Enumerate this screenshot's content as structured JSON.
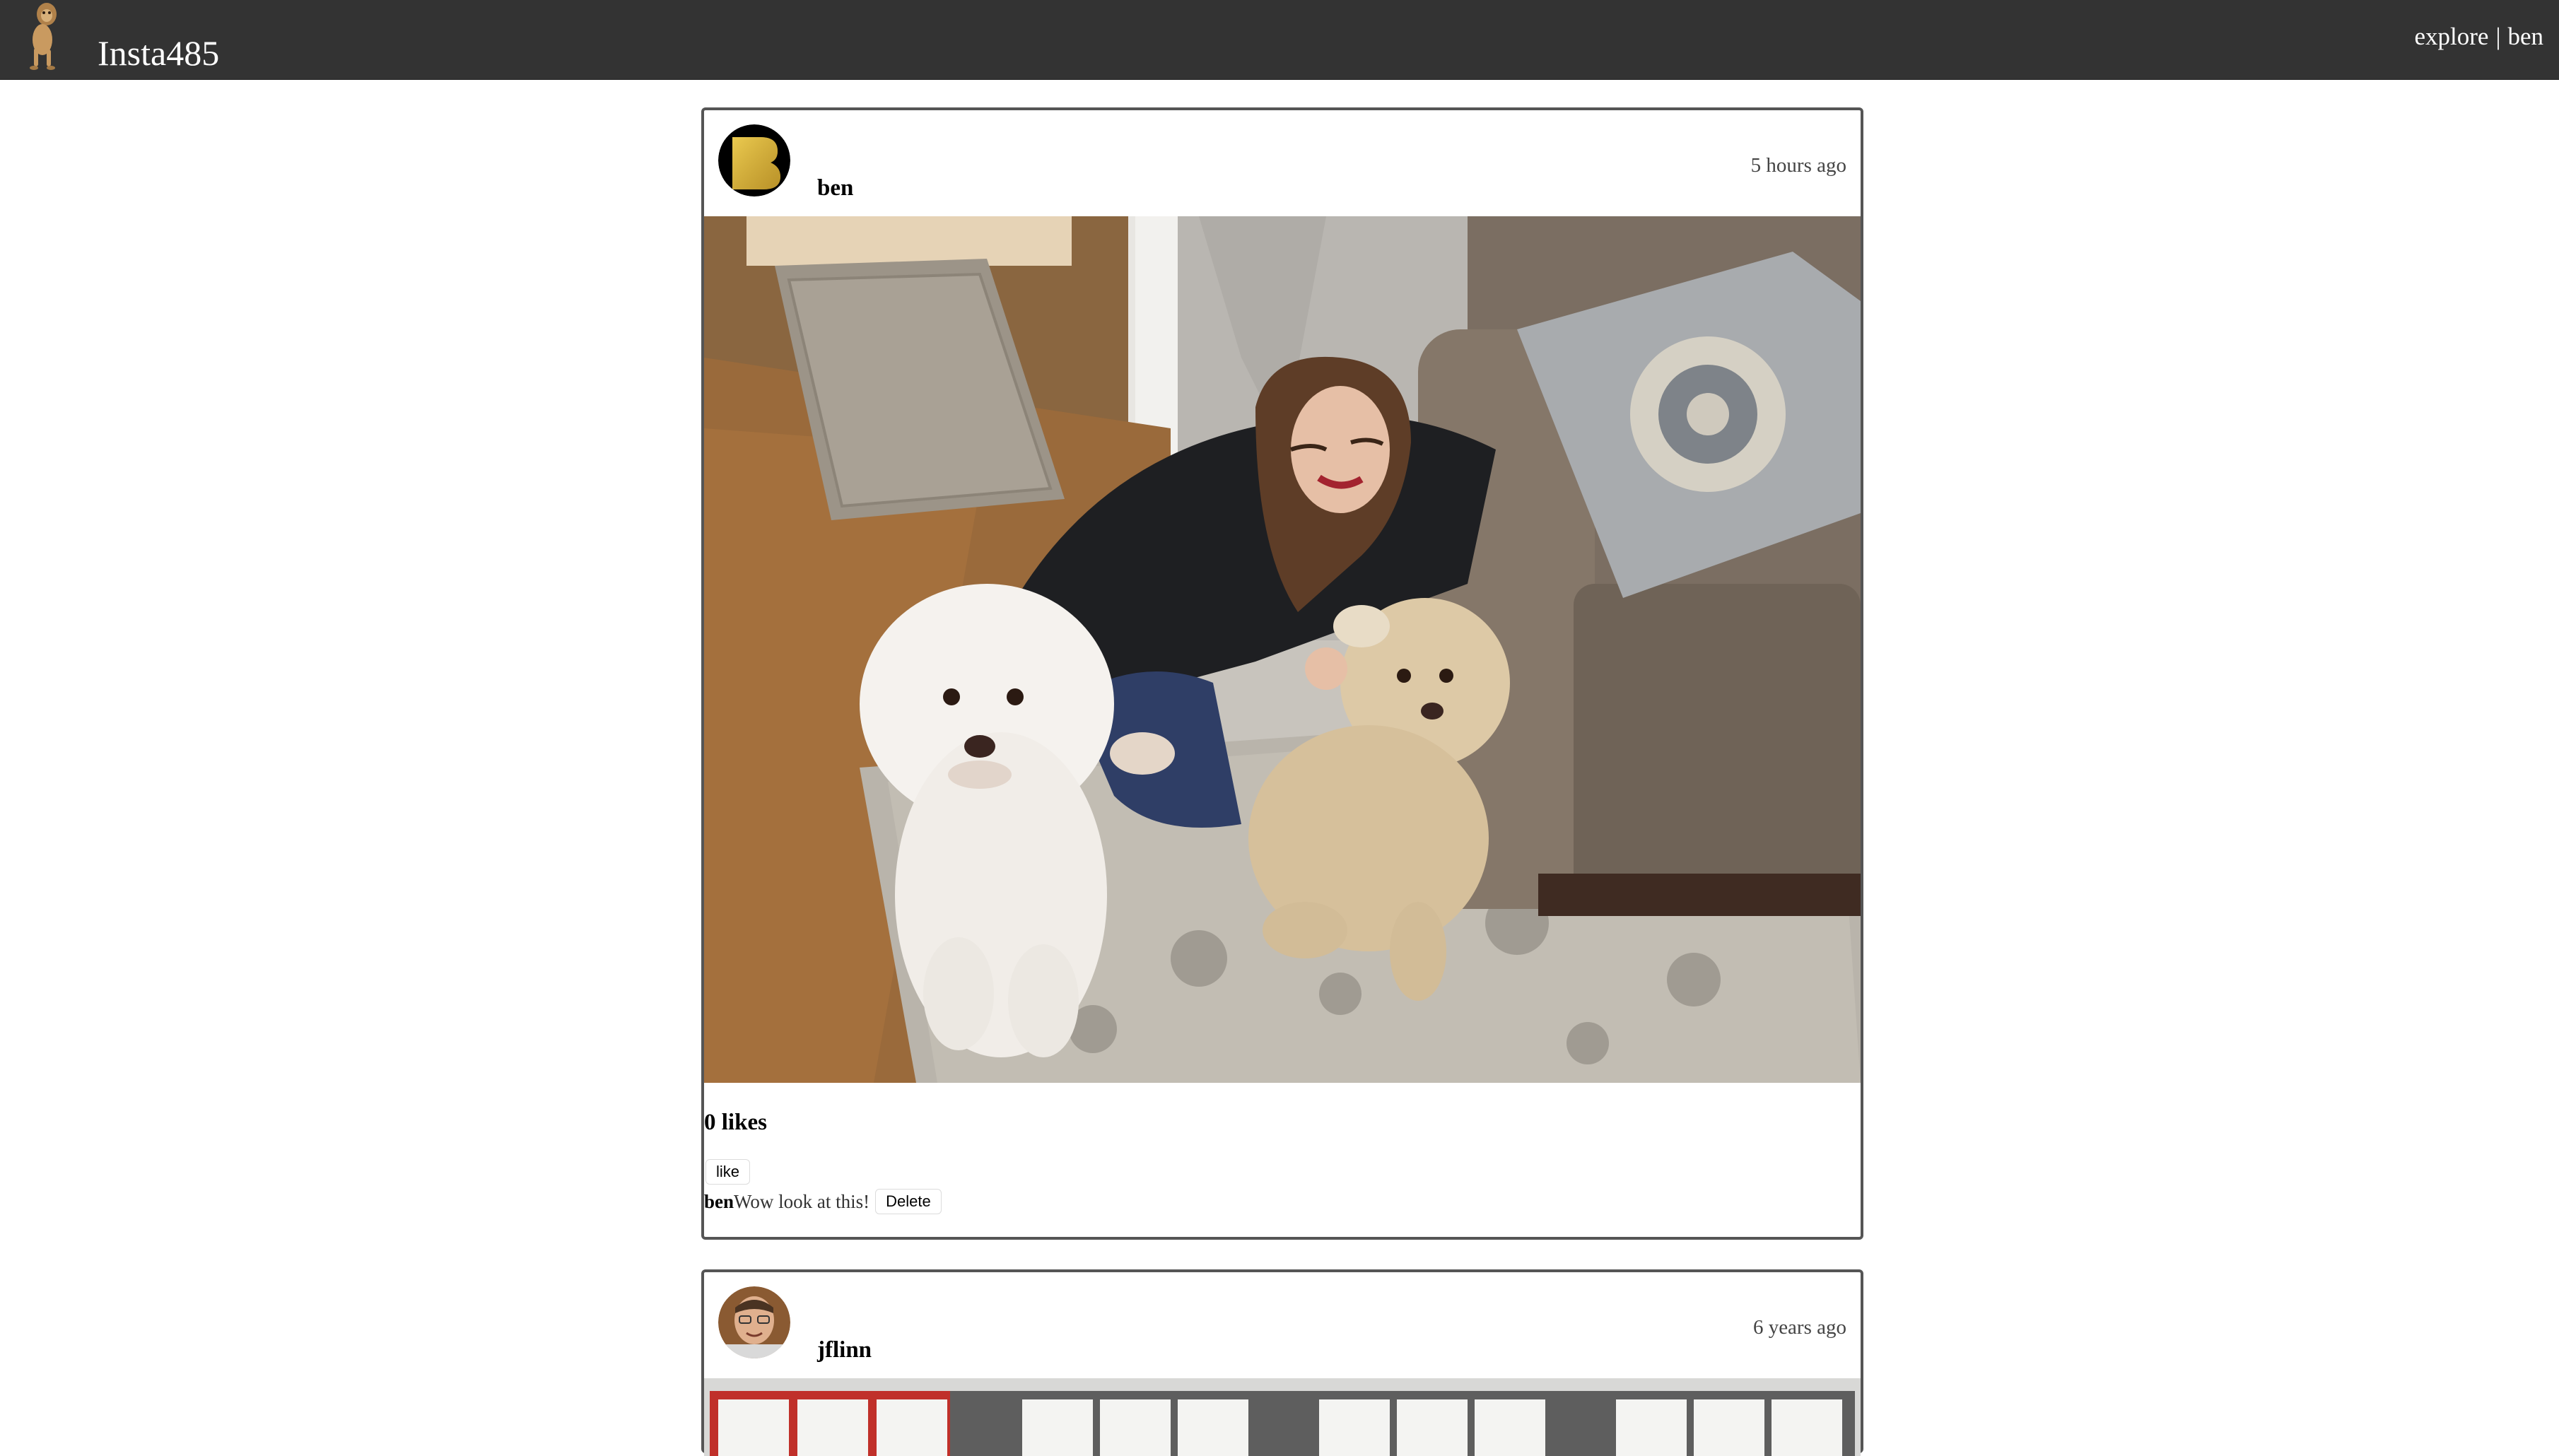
{
  "header": {
    "brand": "Insta485",
    "logo_icon": "dog-logo-icon",
    "nav_explore": "explore",
    "nav_separator": "|",
    "nav_user": "ben"
  },
  "posts": [
    {
      "owner": "ben",
      "timestamp": "5 hours ago",
      "likes": "0 likes",
      "like_label": "like",
      "comments": [
        {
          "owner": "ben",
          "text": "Wow look at this!",
          "delete_label": "Delete"
        }
      ]
    },
    {
      "owner": "jflinn",
      "timestamp": "6 years ago"
    }
  ],
  "colors": {
    "header_bg": "#333333",
    "post_border": "#555555",
    "avatar_ben": "#d4a92a"
  }
}
